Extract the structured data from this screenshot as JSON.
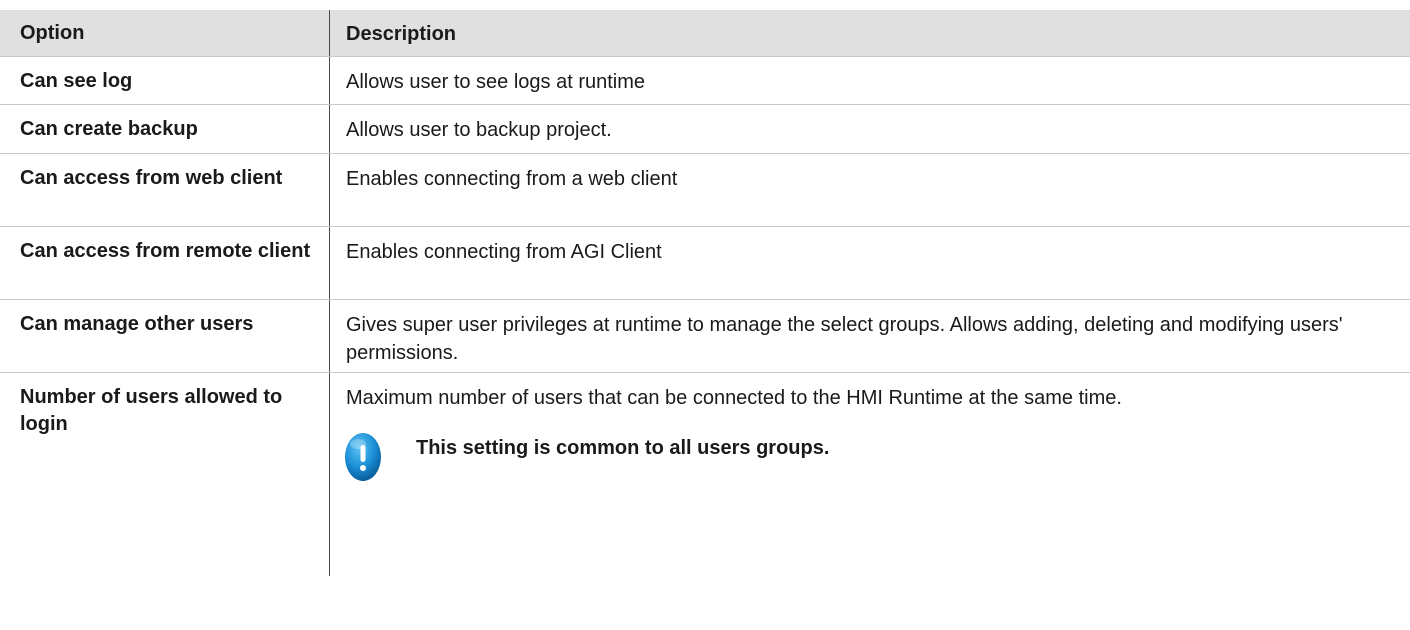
{
  "table": {
    "header": {
      "option": "Option",
      "description": "Description"
    },
    "rows": [
      {
        "option": "Can see log",
        "description": "Allows user to see logs at runtime"
      },
      {
        "option": "Can create backup",
        "description": "Allows user to backup project."
      },
      {
        "option": "Can access from web client",
        "description": "Enables connecting from a web client"
      },
      {
        "option": "Can access from remote client",
        "description": "Enables connecting from AGI Client"
      },
      {
        "option": "Can manage other users",
        "description": "Gives super user privileges at runtime to manage the select groups. Allows adding, deleting and modifying users' permissions."
      },
      {
        "option": "Number of users allowed to login",
        "description": "Maximum number of users that can be connected to the HMI Runtime at the same time."
      }
    ],
    "note": {
      "icon": "exclamation-icon",
      "text": "This setting is common to all users groups."
    }
  },
  "colors": {
    "header_background": "#e0e0e0",
    "icon_blue": "#1a8fd6",
    "divider": "#c8c8c8"
  }
}
